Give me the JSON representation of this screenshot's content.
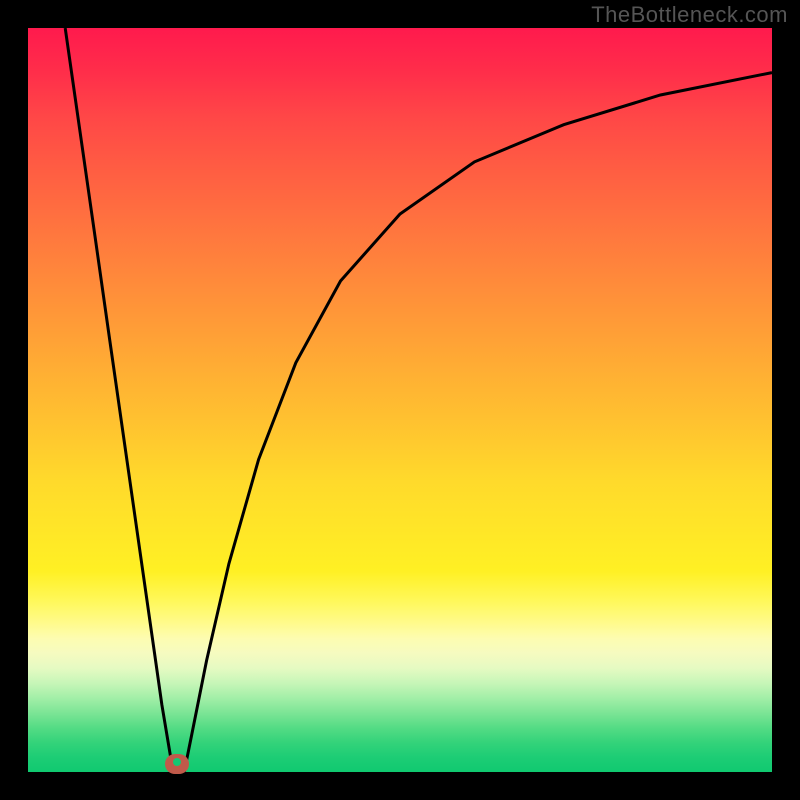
{
  "watermark": "TheBottleneck.com",
  "colors": {
    "frame_border": "#000000",
    "curve_stroke": "#000000",
    "bump_fill": "#c05a4a",
    "gradient_top": "#ff1a4d",
    "gradient_bottom": "#10c970"
  },
  "chart_data": {
    "type": "line",
    "title": "",
    "xlabel": "",
    "ylabel": "",
    "xlim": [
      0,
      100
    ],
    "ylim": [
      0,
      100
    ],
    "grid": false,
    "legend": false,
    "series": [
      {
        "name": "left_branch",
        "x": [
          5,
          7,
          9,
          11,
          13,
          15,
          17,
          18,
          19,
          19.5
        ],
        "values": [
          100,
          86,
          72,
          58,
          44,
          30,
          16,
          9,
          3,
          0
        ]
      },
      {
        "name": "right_branch",
        "x": [
          21,
          22,
          24,
          27,
          31,
          36,
          42,
          50,
          60,
          72,
          85,
          100
        ],
        "values": [
          0,
          5,
          15,
          28,
          42,
          55,
          66,
          75,
          82,
          87,
          91,
          94
        ]
      }
    ],
    "annotations": [
      {
        "name": "minimum_marker",
        "x": 20,
        "y": 0
      }
    ],
    "background_gradient": {
      "direction": "top-to-bottom",
      "stops": [
        {
          "pos": 0.0,
          "color": "#ff1a4d"
        },
        {
          "pos": 0.4,
          "color": "#ff9c37"
        },
        {
          "pos": 0.7,
          "color": "#ffe727"
        },
        {
          "pos": 0.82,
          "color": "#fdfcb0"
        },
        {
          "pos": 1.0,
          "color": "#10c970"
        }
      ]
    }
  }
}
